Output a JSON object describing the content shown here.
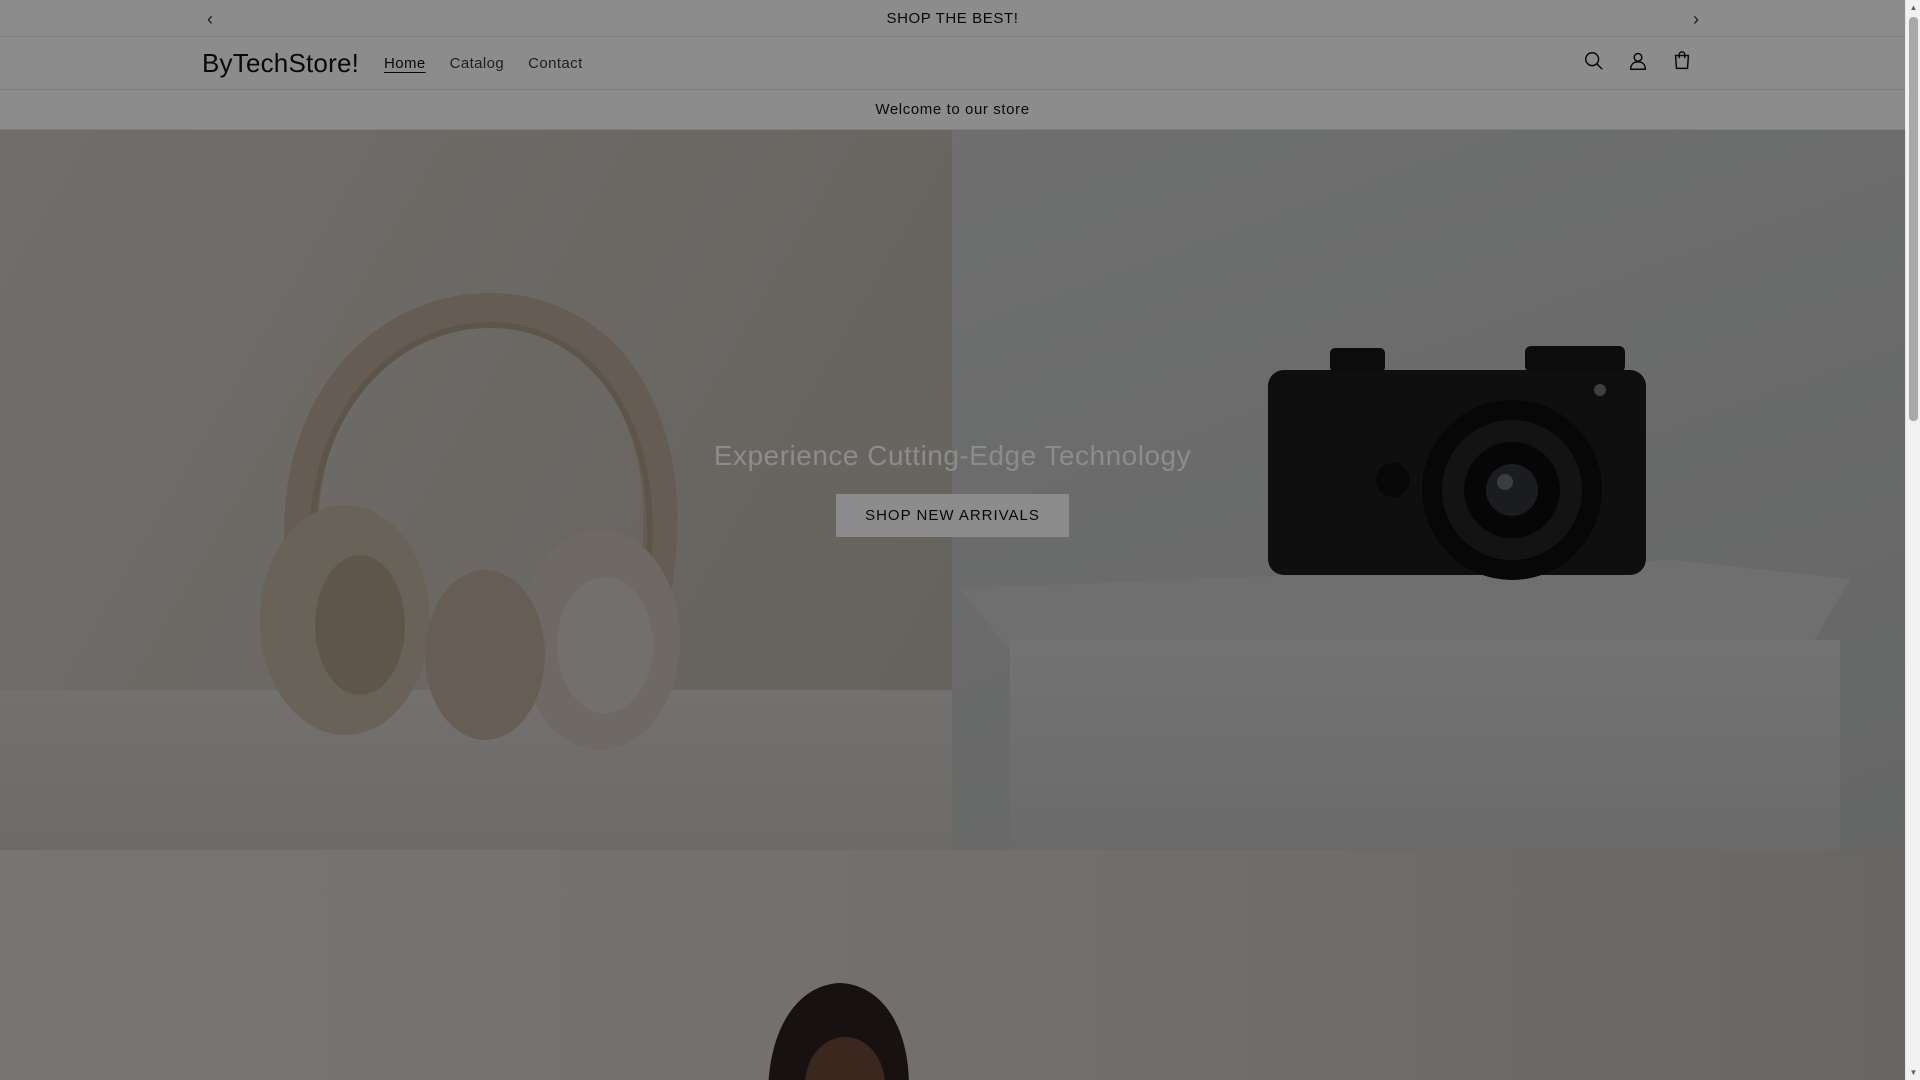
{
  "announcement": {
    "text": "SHOP THE BEST!",
    "prev_icon": "chevron-left-icon",
    "next_icon": "chevron-right-icon"
  },
  "header": {
    "logo": "ByTechStore!",
    "nav": [
      {
        "label": "Home",
        "active": true
      },
      {
        "label": "Catalog",
        "active": false
      },
      {
        "label": "Contact",
        "active": false
      }
    ],
    "icons": [
      "search-icon",
      "account-icon",
      "cart-icon"
    ]
  },
  "welcome": {
    "text": "Welcome to our store"
  },
  "hero": {
    "title": "Experience Cutting-Edge Technology",
    "button_label": "SHOP NEW ARRIVALS"
  },
  "colors": {
    "overlay": "#000000",
    "button_bg": "#ffffff"
  }
}
